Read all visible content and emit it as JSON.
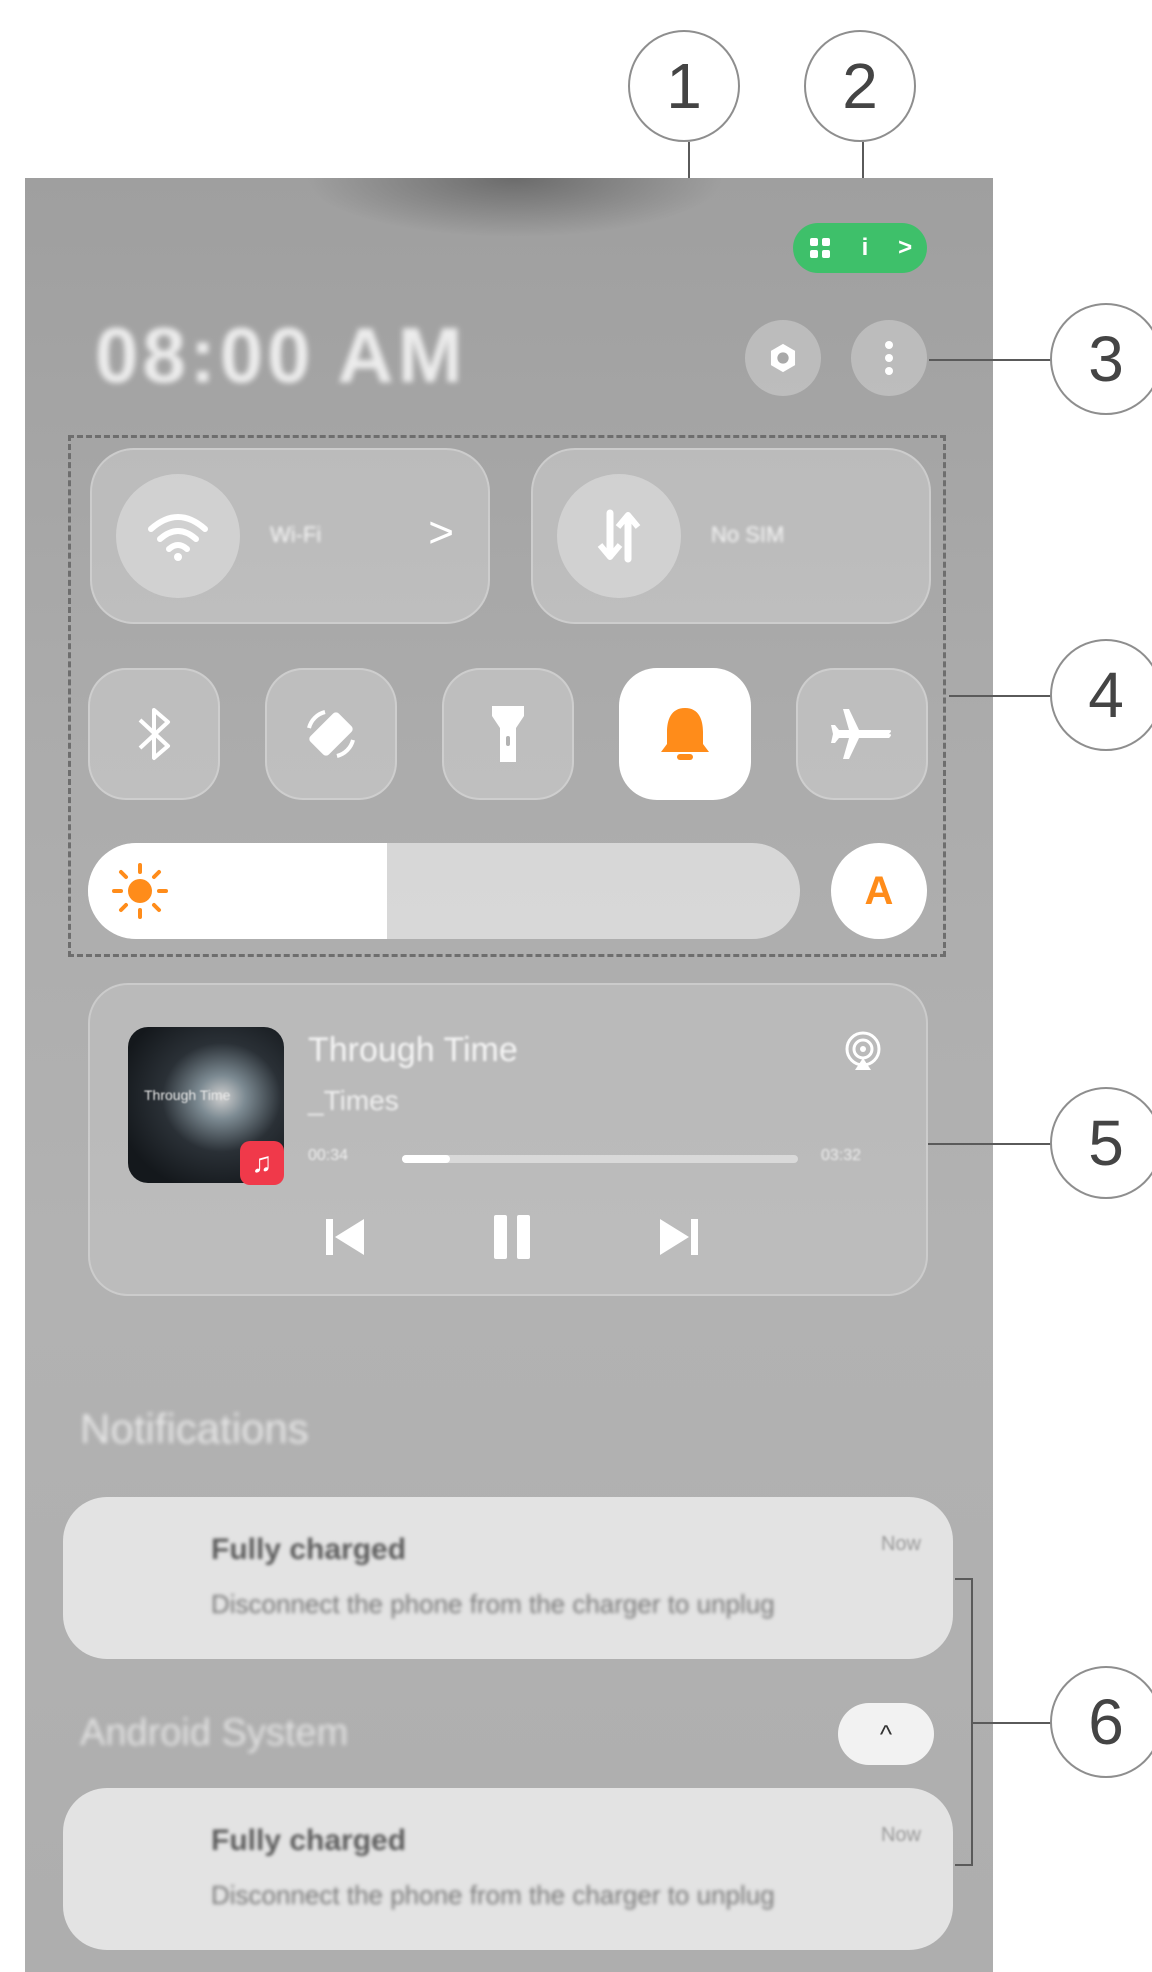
{
  "callouts": [
    "1",
    "2",
    "3",
    "4",
    "5",
    "6"
  ],
  "status_chip": {
    "left_icon": "grid-icon",
    "right_text": "i",
    "chevron": ">",
    "color": "#3ec06a"
  },
  "header": {
    "clock": "08:00 AM",
    "settings_icon": "gear-icon",
    "more_icon": "more-vert-icon"
  },
  "quick_settings": {
    "wifi": {
      "label": "Wi-Fi",
      "chevron": ">",
      "icon": "wifi-icon"
    },
    "data": {
      "label": "No SIM",
      "icon": "data-transfer-icon"
    },
    "toggles": [
      {
        "name": "bluetooth",
        "icon": "bluetooth-icon",
        "active": false
      },
      {
        "name": "auto-rotate",
        "icon": "rotate-icon",
        "active": false
      },
      {
        "name": "flashlight",
        "icon": "flashlight-icon",
        "active": false
      },
      {
        "name": "sound",
        "icon": "bell-icon",
        "active": true
      },
      {
        "name": "airplane",
        "icon": "airplane-icon",
        "active": false
      }
    ],
    "brightness": {
      "level": 0.42,
      "auto_label": "A",
      "accent": "#ff8c1a"
    }
  },
  "media": {
    "title": "Through Time",
    "artist": "_Times",
    "album_art_text": "Through Time",
    "elapsed": "00:34",
    "duration": "03:32",
    "progress": 0.12,
    "badge_icon": "music-note-icon",
    "badge_glyph": "♫",
    "badge_color": "#f0394a"
  },
  "notifications": {
    "heading": "Notifications",
    "items": [
      {
        "title": "Fully charged",
        "body": "Disconnect the phone from the charger to unplug",
        "time": "Now"
      },
      {
        "title": "Fully charged",
        "body": "Disconnect the phone from the charger to unplug",
        "time": "Now"
      }
    ],
    "group_label": "Android System",
    "collapse_glyph": "^"
  }
}
